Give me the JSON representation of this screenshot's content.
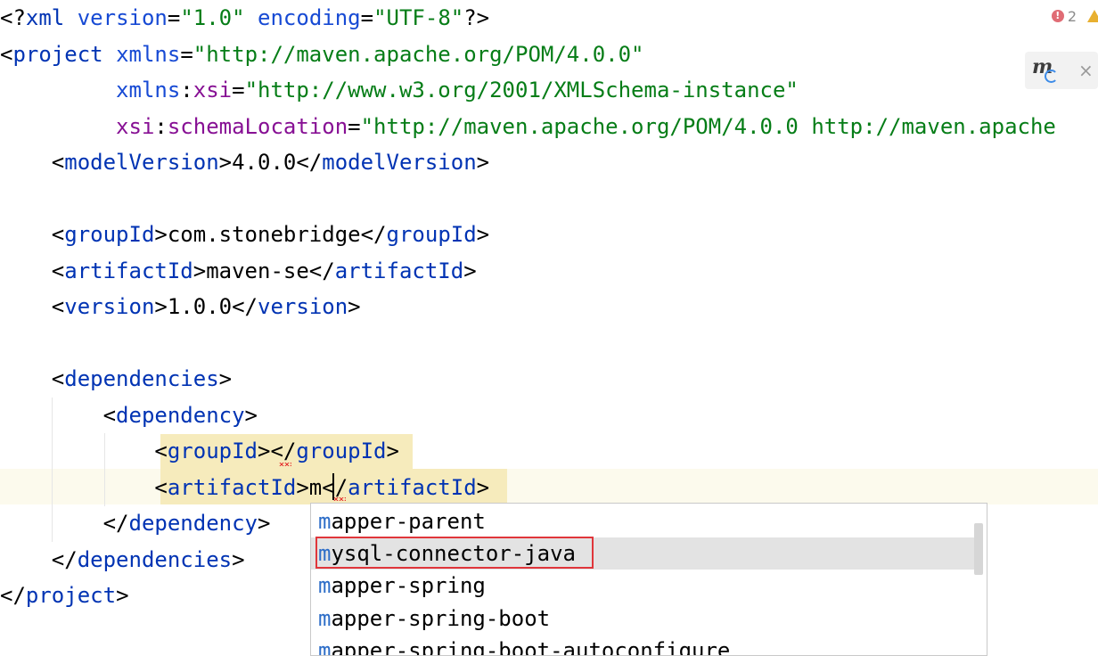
{
  "editor": {
    "lines": [
      {
        "tokens": [
          [
            "br",
            "<?"
          ],
          [
            "tag",
            "xml"
          ],
          [
            "text",
            " "
          ],
          [
            "attr",
            "version"
          ],
          [
            "br",
            "="
          ],
          [
            "str",
            "\"1.0\""
          ],
          [
            "text",
            " "
          ],
          [
            "attr",
            "encoding"
          ],
          [
            "br",
            "="
          ],
          [
            "str",
            "\"UTF-8\""
          ],
          [
            "br",
            "?>"
          ]
        ]
      },
      {
        "tokens": [
          [
            "br",
            "<"
          ],
          [
            "tag",
            "project"
          ],
          [
            "text",
            " "
          ],
          [
            "attr",
            "xmlns"
          ],
          [
            "br",
            "="
          ],
          [
            "str",
            "\"http://maven.apache.org/POM/4.0.0\""
          ]
        ]
      },
      {
        "tokens": [
          [
            "text",
            "         "
          ],
          [
            "attr",
            "xmlns"
          ],
          [
            "br",
            ":"
          ],
          [
            "ns",
            "xsi"
          ],
          [
            "br",
            "="
          ],
          [
            "str",
            "\"http://www.w3.org/2001/XMLSchema-instance\""
          ]
        ]
      },
      {
        "tokens": [
          [
            "text",
            "         "
          ],
          [
            "ns",
            "xsi"
          ],
          [
            "br",
            ":"
          ],
          [
            "ns",
            "schemaLocation"
          ],
          [
            "br",
            "="
          ],
          [
            "str",
            "\"http://maven.apache.org/POM/4.0.0 http://maven.apache"
          ]
        ]
      },
      {
        "tokens": [
          [
            "text",
            "    "
          ],
          [
            "br",
            "<"
          ],
          [
            "tag",
            "modelVersion"
          ],
          [
            "br",
            ">"
          ],
          [
            "text",
            "4.0.0"
          ],
          [
            "br",
            "</"
          ],
          [
            "tag",
            "modelVersion"
          ],
          [
            "br",
            ">"
          ]
        ]
      },
      {
        "tokens": []
      },
      {
        "tokens": [
          [
            "text",
            "    "
          ],
          [
            "br",
            "<"
          ],
          [
            "tag",
            "groupId"
          ],
          [
            "br",
            ">"
          ],
          [
            "text",
            "com.stonebridge"
          ],
          [
            "br",
            "</"
          ],
          [
            "tag",
            "groupId"
          ],
          [
            "br",
            ">"
          ]
        ]
      },
      {
        "tokens": [
          [
            "text",
            "    "
          ],
          [
            "br",
            "<"
          ],
          [
            "tag",
            "artifactId"
          ],
          [
            "br",
            ">"
          ],
          [
            "text",
            "maven-se"
          ],
          [
            "br",
            "</"
          ],
          [
            "tag",
            "artifactId"
          ],
          [
            "br",
            ">"
          ]
        ]
      },
      {
        "tokens": [
          [
            "text",
            "    "
          ],
          [
            "br",
            "<"
          ],
          [
            "tag",
            "version"
          ],
          [
            "br",
            ">"
          ],
          [
            "text",
            "1.0.0"
          ],
          [
            "br",
            "</"
          ],
          [
            "tag",
            "version"
          ],
          [
            "br",
            ">"
          ]
        ]
      },
      {
        "tokens": []
      },
      {
        "tokens": [
          [
            "text",
            "    "
          ],
          [
            "br",
            "<"
          ],
          [
            "tag",
            "dependencies"
          ],
          [
            "br",
            ">"
          ]
        ]
      },
      {
        "tokens": [
          [
            "text",
            "        "
          ],
          [
            "br",
            "<"
          ],
          [
            "tag",
            "dependency"
          ],
          [
            "br",
            ">"
          ]
        ]
      },
      {
        "tokens": [
          [
            "text",
            "            "
          ],
          [
            "br",
            "<"
          ],
          [
            "tag",
            "groupId"
          ],
          [
            "br",
            ">"
          ],
          [
            "br",
            "</"
          ],
          [
            "tag",
            "groupId"
          ],
          [
            "br",
            ">"
          ]
        ]
      },
      {
        "tokens": [
          [
            "text",
            "            "
          ],
          [
            "br",
            "<"
          ],
          [
            "tag",
            "artifactId"
          ],
          [
            "br",
            ">"
          ],
          [
            "text",
            "m"
          ],
          [
            "br",
            "</"
          ],
          [
            "tag",
            "artifactId"
          ],
          [
            "br",
            ">"
          ]
        ]
      },
      {
        "tokens": [
          [
            "text",
            "        "
          ],
          [
            "br",
            "</"
          ],
          [
            "tag",
            "dependency"
          ],
          [
            "br",
            ">"
          ]
        ]
      },
      {
        "tokens": [
          [
            "text",
            "    "
          ],
          [
            "br",
            "</"
          ],
          [
            "tag",
            "dependencies"
          ],
          [
            "br",
            ">"
          ]
        ]
      },
      {
        "tokens": [
          [
            "br",
            "</"
          ],
          [
            "tag",
            "project"
          ],
          [
            "br",
            ">"
          ]
        ]
      }
    ]
  },
  "inspection": {
    "error_count": "2",
    "error_glyph": "!",
    "warning_glyph": "!"
  },
  "maven_popup": {
    "icon": "maven-reload-icon",
    "close_label": "×"
  },
  "completion": {
    "typed_prefix": "m",
    "items": [
      {
        "prefix": "m",
        "rest": "apper-parent",
        "selected": false
      },
      {
        "prefix": "m",
        "rest": "ysql-connector-java",
        "selected": true
      },
      {
        "prefix": "m",
        "rest": "apper-spring",
        "selected": false
      },
      {
        "prefix": "m",
        "rest": "apper-spring-boot",
        "selected": false
      },
      {
        "prefix": "m",
        "rest": "apper-spring-boot-autoconfigure",
        "selected": false
      }
    ]
  },
  "colors": {
    "tag": "#0033b3",
    "attr": "#174ad4",
    "namespace": "#871094",
    "string": "#067d17",
    "match": "#2e6ec8",
    "highlight_box": "#e0363b"
  }
}
